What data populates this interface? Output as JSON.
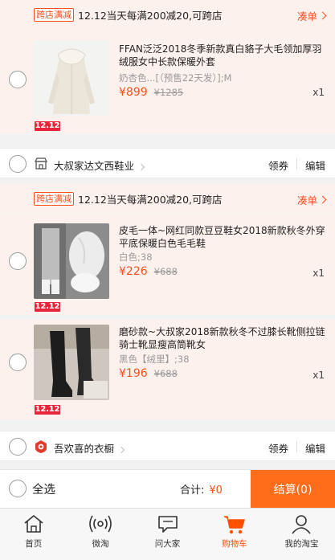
{
  "colors": {
    "accent": "#ff4f1c",
    "checkout_button": "#ff6c1a",
    "promo_bg": "#fdf1ee",
    "badge_1212": "#e8233a"
  },
  "groups": [
    {
      "promo": {
        "tag": "跨店满减",
        "text": "12.12当天每满200减20,可跨店",
        "more": "凑单"
      },
      "items": [
        {
          "title": "FFAN泛泛2018冬季新款真白貉子大毛领加厚羽绒服女中长款保暖外套",
          "spec": "奶杏色...[（预售22天发）];M",
          "price": "¥899",
          "orig_price": "¥1285",
          "qty": "x1",
          "badge": "12.12",
          "image": "white-long-down-coat"
        }
      ],
      "shop": {
        "name": "大叔家达文西鞋业",
        "coupon": "领券",
        "edit": "编辑",
        "icon": "shop-icon"
      }
    },
    {
      "promo": {
        "tag": "跨店满减",
        "text": "12.12当天每满200减20,可跨店",
        "more": "凑单"
      },
      "items": [
        {
          "title": "皮毛一体~网红同款豆豆鞋女2018新款秋冬外穿平底保暖白色毛毛鞋",
          "spec": "白色;38",
          "price": "¥226",
          "orig_price": "¥688",
          "qty": "x1",
          "badge": "12.12",
          "image": "white-fur-shoes"
        },
        {
          "title": "磨砂款~大叔家2018新款秋冬不过膝长靴侧拉链骑士靴显瘦高筒靴女",
          "spec": "黑色【绒里】;38",
          "price": "¥196",
          "orig_price": "¥688",
          "qty": "x1",
          "badge": "12.12",
          "image": "black-knee-boots"
        }
      ],
      "shop": {
        "name": "吾欢喜的衣橱",
        "coupon": "领券",
        "edit": "编辑",
        "icon": "shop-logo-icon"
      }
    }
  ],
  "checkout": {
    "select_all": "全选",
    "total_label": "合计:",
    "total_value": "¥0",
    "button": "结算(0)"
  },
  "tabbar": [
    {
      "label": "首页",
      "icon": "home-icon"
    },
    {
      "label": "微淘",
      "icon": "broadcast-icon"
    },
    {
      "label": "问大家",
      "icon": "chat-icon"
    },
    {
      "label": "购物车",
      "icon": "cart-icon",
      "active": true
    },
    {
      "label": "我的淘宝",
      "icon": "profile-icon"
    }
  ]
}
